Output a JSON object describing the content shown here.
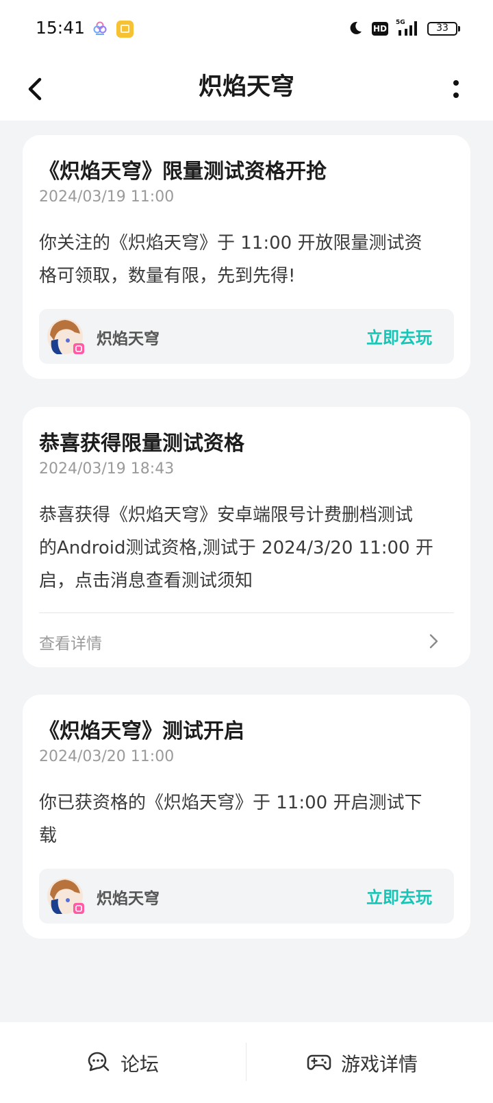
{
  "status_bar": {
    "time": "15:41",
    "network": "5G",
    "hd_badge": "HD",
    "battery": "33"
  },
  "header": {
    "title": "炽焰天穹"
  },
  "cards": [
    {
      "title": "《炽焰天穹》限量测试资格开抢",
      "date": "2024/03/19 11:00",
      "body_line1": "你关注的《炽焰天穹》于 11:00 开放限量测试资",
      "body_line2": "格可领取，数量有限，先到先得!",
      "game_name": "炽焰天穹",
      "action_label": "立即去玩"
    },
    {
      "title": "恭喜获得限量测试资格",
      "date": "2024/03/19 18:43",
      "body_line1": "恭喜获得《炽焰天穹》安卓端限号计费删档测试",
      "body_line2": "的Android测试资格,测试于 2024/3/20 11:00 开",
      "body_line3": "启，点击消息查看测试须知",
      "detail_label": "查看详情"
    },
    {
      "title": "《炽焰天穹》测试开启",
      "date": "2024/03/20 11:00",
      "body_line1": "你已获资格的《炽焰天穹》于 11:00 开启测试下",
      "body_line2": "载",
      "game_name": "炽焰天穹",
      "action_label": "立即去玩"
    }
  ],
  "bottom_nav": {
    "forum_label": "论坛",
    "game_detail_label": "游戏详情"
  },
  "colors": {
    "accent": "#17c5b6",
    "background": "#f3f4f6"
  }
}
